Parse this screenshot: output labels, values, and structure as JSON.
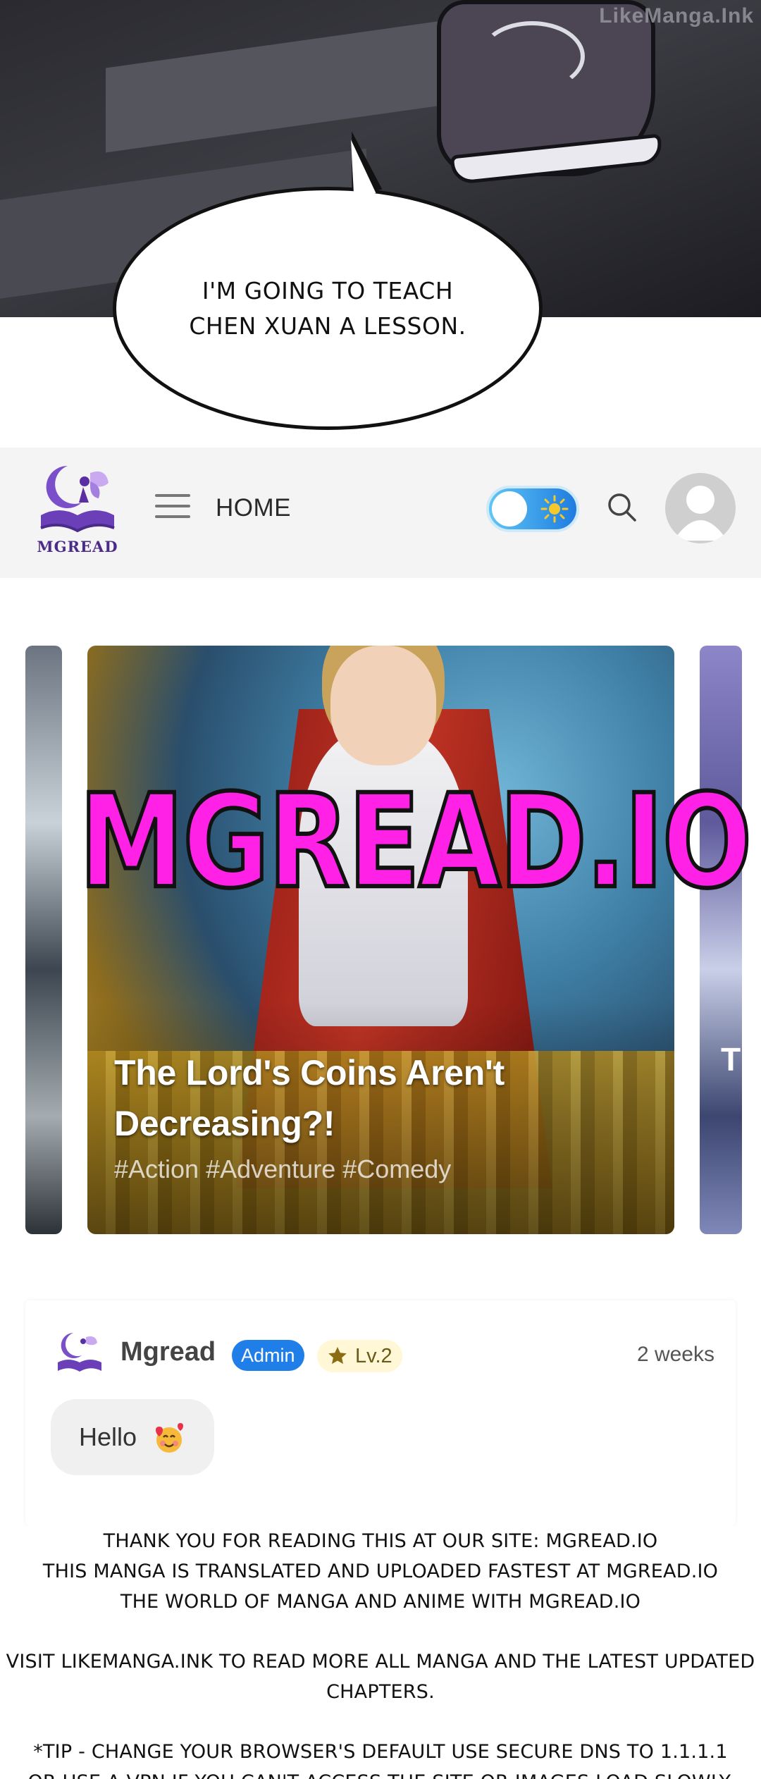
{
  "comic": {
    "watermark": "LikeManga.Ink",
    "speech_line_1": "I'M GOING TO TEACH",
    "speech_line_2": "CHEN XUAN A LESSON."
  },
  "header": {
    "logo_text": "MGREAD",
    "menu_icon": "hamburger-menu-icon",
    "home_label": "HOME",
    "theme_icon": "sun-icon",
    "search_icon": "search-icon",
    "avatar_icon": "user-avatar-icon"
  },
  "carousel": {
    "featured": {
      "title_line_1": "The Lord's Coins Aren't",
      "title_line_2": "Decreasing?!",
      "tags": "#Action #Adventure #Comedy"
    },
    "right_peek_text": "T",
    "brand_overlay": "MGREAD.IO"
  },
  "comment": {
    "author": "Mgread",
    "role_badge": "Admin",
    "level": "Lv.2",
    "time": "2 weeks",
    "text": "Hello",
    "emoji": "smiling-face-with-hearts"
  },
  "footer": {
    "line_1": "THANK YOU FOR READING THIS AT OUR SITE: MGREAD.IO",
    "line_2": "THIS MANGA IS TRANSLATED AND UPLOADED FASTEST AT MGREAD.IO",
    "line_3": "THE WORLD OF MANGA AND ANIME WITH MGREAD.IO",
    "line_4": "VISIT LIKEMANGA.INK TO READ MORE ALL MANGA AND THE LATEST UPDATED CHAPTERS.",
    "line_5": "*TIP - CHANGE YOUR BROWSER'S DEFAULT USE SECURE DNS TO 1.1.1.1",
    "line_6": "OR USE A VPN IF YOU CAN'T ACCESS THE SITE OR IMAGES LOAD SLOWLY."
  },
  "colors": {
    "brand_purple": "#4b2a8a",
    "brand_overlay_pink": "#ff22e6",
    "admin_blue": "#1f7ee8",
    "toggle_blue": "#1f7ce0"
  }
}
